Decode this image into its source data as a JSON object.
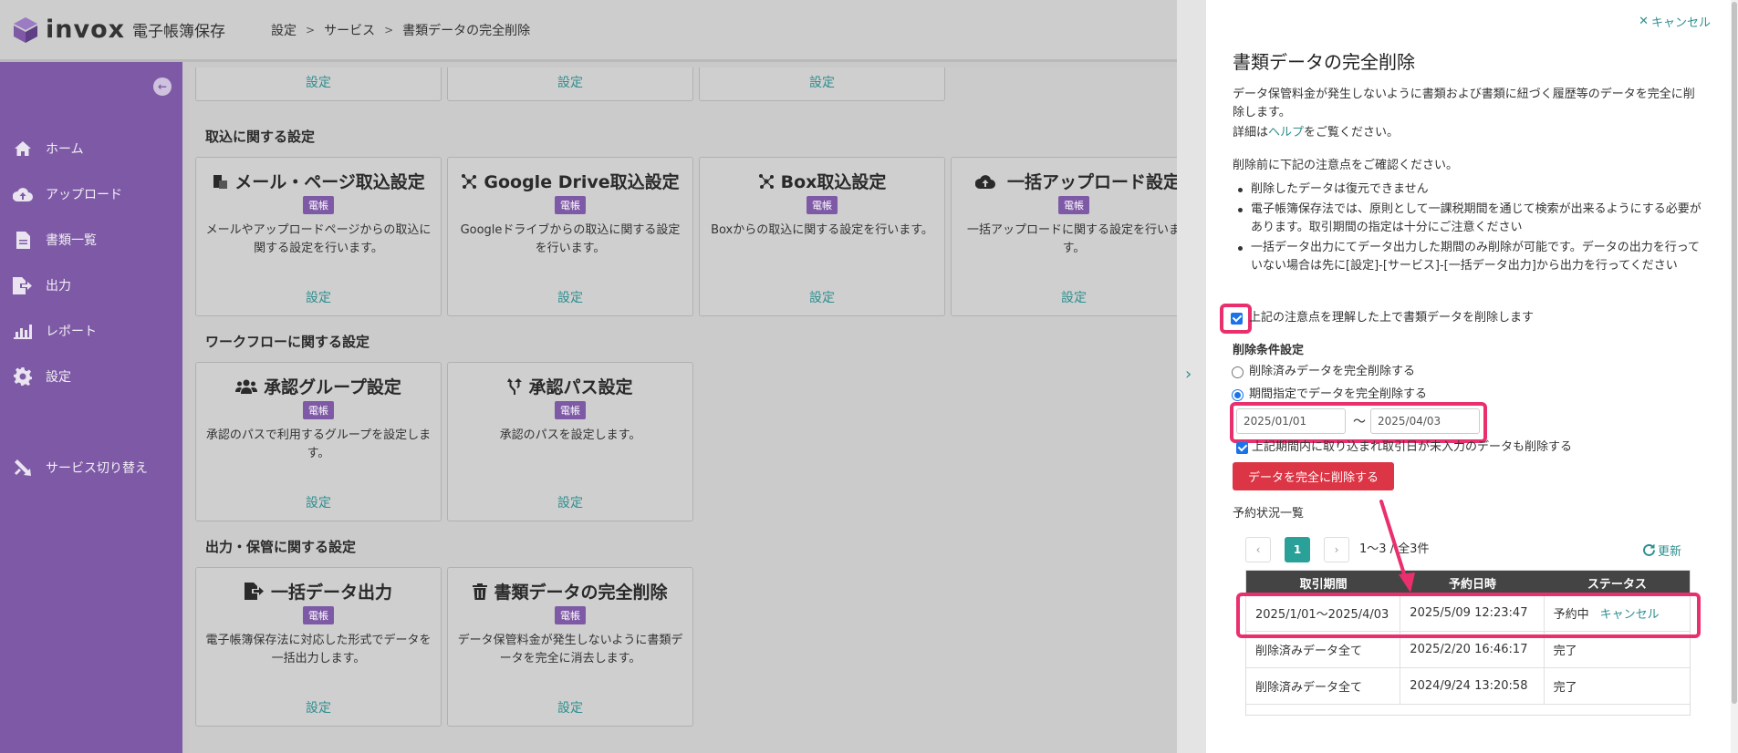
{
  "header": {
    "logo_text": "invox",
    "logo_sub": "電子帳簿保存",
    "breadcrumb": [
      "設定",
      "サービス",
      "書類データの完全削除"
    ]
  },
  "sidebar": {
    "items": [
      {
        "label": "ホーム",
        "icon": "home-icon"
      },
      {
        "label": "アップロード",
        "icon": "upload-icon"
      },
      {
        "label": "書類一覧",
        "icon": "document-icon"
      },
      {
        "label": "出力",
        "icon": "export-icon"
      },
      {
        "label": "レポート",
        "icon": "report-icon"
      },
      {
        "label": "設定",
        "icon": "gear-icon"
      },
      {
        "label": "サービス切り替え",
        "icon": "switch-icon"
      }
    ]
  },
  "main": {
    "top_links": [
      "設定",
      "設定",
      "設定"
    ],
    "sections": [
      {
        "title": "取込に関する設定",
        "cards": [
          {
            "title": "メール・ページ取込設定",
            "badge": "電帳",
            "desc": "メールやアップロードページからの取込に関する設定を行います。",
            "link": "設定"
          },
          {
            "title": "Google Drive取込設定",
            "badge": "電帳",
            "desc": "Googleドライブからの取込に関する設定を行います。",
            "link": "設定"
          },
          {
            "title": "Box取込設定",
            "badge": "電帳",
            "desc": "Boxからの取込に関する設定を行います。",
            "link": "設定"
          },
          {
            "title": "一括アップロード設定",
            "badge": "電帳",
            "desc": "一括アップロードに関する設定を行います。",
            "link": "設定"
          }
        ]
      },
      {
        "title": "ワークフローに関する設定",
        "cards": [
          {
            "title": "承認グループ設定",
            "badge": "電帳",
            "desc": "承認のパスで利用するグループを設定します。",
            "link": "設定"
          },
          {
            "title": "承認パス設定",
            "badge": "電帳",
            "desc": "承認のパスを設定します。",
            "link": "設定"
          }
        ]
      },
      {
        "title": "出力・保管に関する設定",
        "cards": [
          {
            "title": "一括データ出力",
            "badge": "電帳",
            "desc": "電子帳簿保存法に対応した形式でデータを一括出力します。",
            "link": "設定"
          },
          {
            "title": "書類データの完全削除",
            "badge": "電帳",
            "desc": "データ保管料金が発生しないように書類データを完全に消去します。",
            "link": "設定"
          }
        ]
      }
    ]
  },
  "panel": {
    "close_label": "キャンセル",
    "title": "書類データの完全削除",
    "intro": "データ保管料金が発生しないように書類および書類に紐づく履歴等のデータを完全に削除します。",
    "help_prefix": "詳細は",
    "help_link": "ヘルプ",
    "help_suffix": "をご覧ください。",
    "notice_lead": "削除前に下記の注意点をご確認ください。",
    "notices": [
      "削除したデータは復元できません",
      "電子帳簿保存法では、原則として一課税期間を通じて検索が出来るようにする必要があります。取引期間の指定は十分にご注意ください",
      "一括データ出力にてデータ出力した期間のみ削除が可能です。データの出力を行っていない場合は先に[設定]-[サービス]-[一括データ出力]から出力を行ってください"
    ],
    "confirm_label": "上記の注意点を理解した上で書類データを削除します",
    "conditions_title": "削除条件設定",
    "option_deleted": "削除済みデータを完全削除する",
    "option_period": "期間指定でデータを完全削除する",
    "date_from": "2025/01/01",
    "date_to": "2025/04/03",
    "tilde": "〜",
    "include_blank_label": "上記期間内に取り込まれ取引日が未入力のデータも削除する",
    "delete_button": "データを完全に削除する",
    "reservations_title": "予約状況一覧",
    "pager": {
      "prev": "‹",
      "page": "1",
      "next": "›",
      "summary": "1〜3 / 全3件"
    },
    "refresh_label": "更新",
    "table": {
      "headers": [
        "取引期間",
        "予約日時",
        "ステータス"
      ],
      "rows": [
        {
          "period": "2025/1/01〜2025/4/03",
          "reserved_at": "2025/5/09 12:23:47",
          "status": "予約中",
          "action": "キャンセル"
        },
        {
          "period": "削除済みデータ全て",
          "reserved_at": "2025/2/20 16:46:17",
          "status": "完了",
          "action": ""
        },
        {
          "period": "削除済みデータ全て",
          "reserved_at": "2024/9/24 13:20:58",
          "status": "完了",
          "action": ""
        }
      ]
    }
  },
  "colors": {
    "sidebar": "#7e5aa6",
    "accent": "#2f8f8f",
    "danger": "#dc3545",
    "highlight": "#ea2f6d",
    "badge": "#7e5aa6"
  }
}
